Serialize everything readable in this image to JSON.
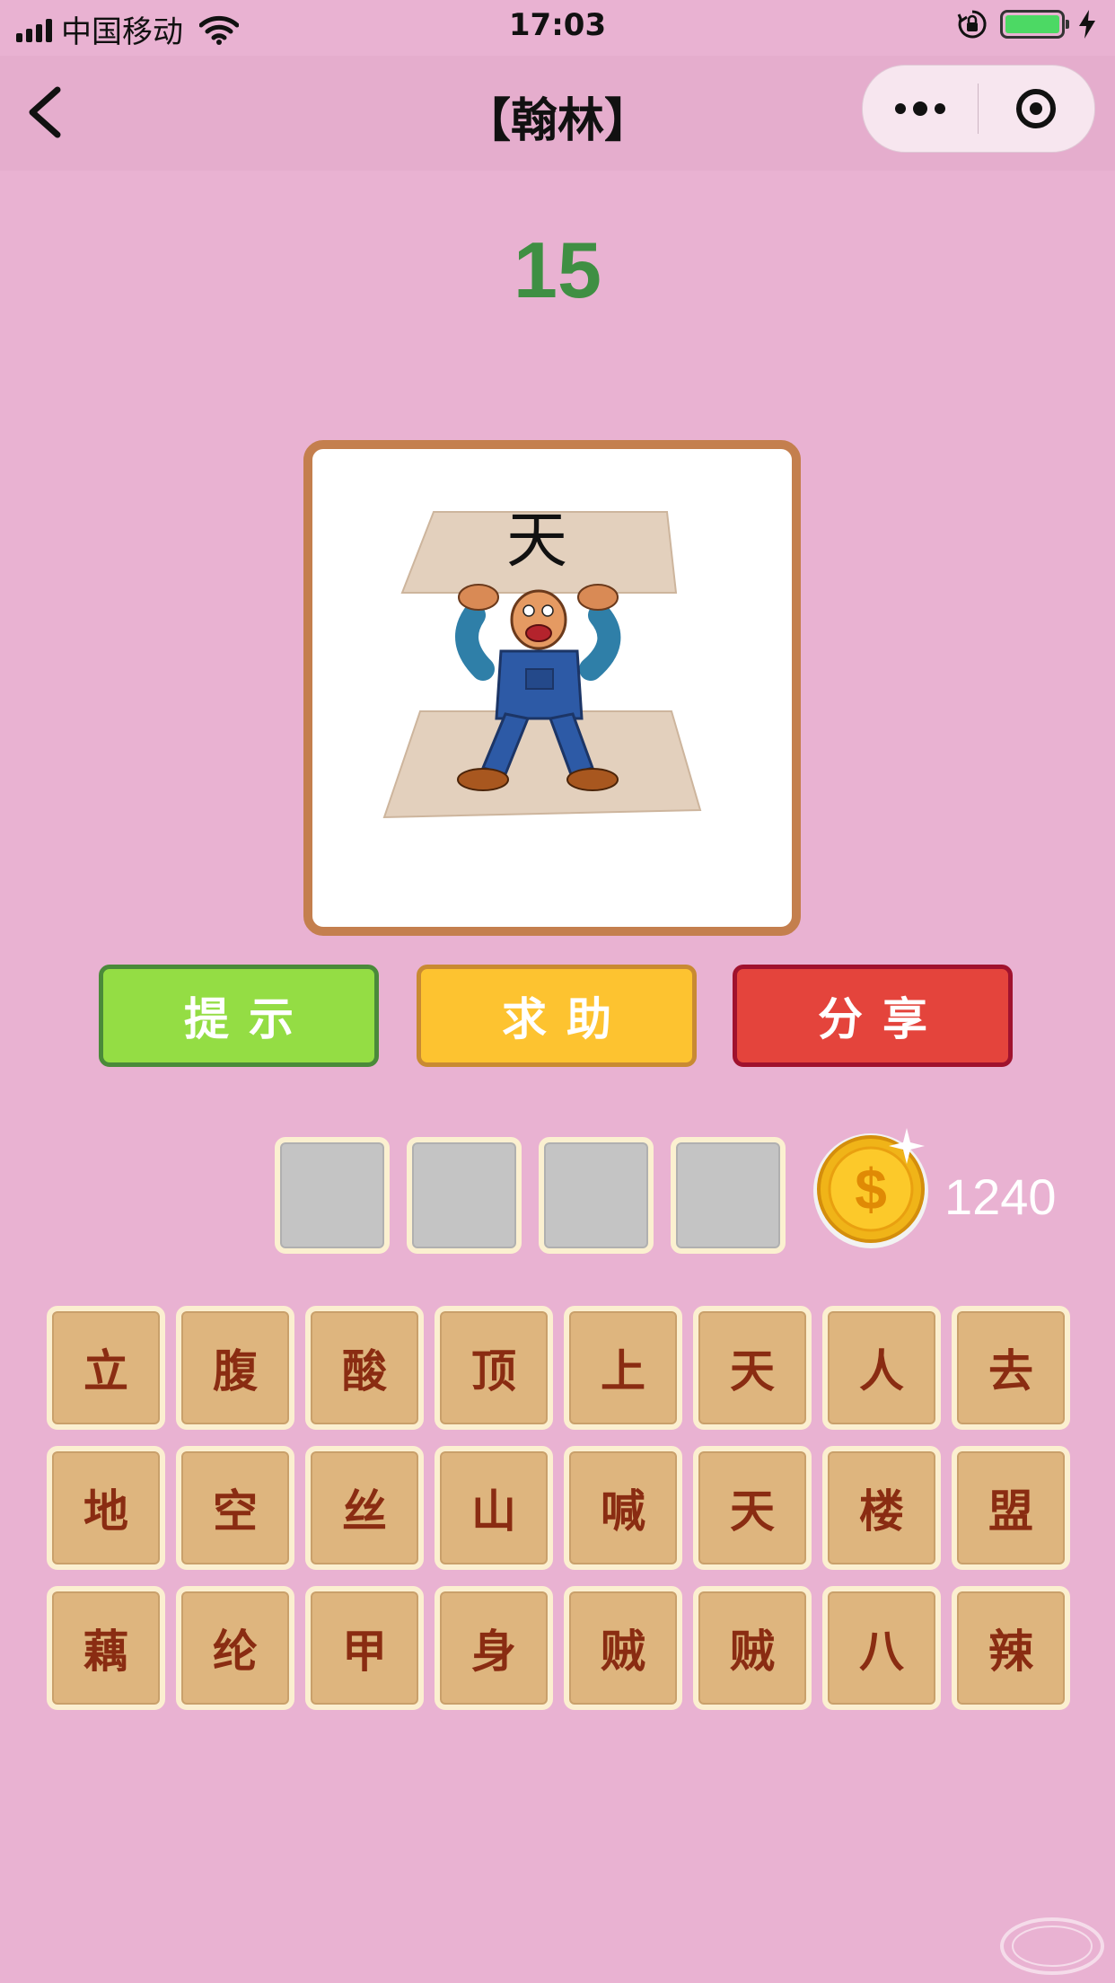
{
  "status_bar": {
    "carrier": "中国移动",
    "time": "17:03",
    "battery_level": 1.0
  },
  "nav": {
    "title": "【翰林】"
  },
  "game": {
    "level": "15",
    "picture_character": "天",
    "buttons": {
      "hint": "提示",
      "help": "求助",
      "share": "分享"
    },
    "answer_slots": [
      "",
      "",
      "",
      ""
    ],
    "coins": "1240",
    "candidate_rows": [
      [
        "立",
        "腹",
        "酸",
        "顶",
        "上",
        "天",
        "人",
        "去"
      ],
      [
        "地",
        "空",
        "丝",
        "山",
        "喊",
        "天",
        "楼",
        "盟"
      ],
      [
        "藕",
        "纶",
        "甲",
        "身",
        "贼",
        "贼",
        "八",
        "辣"
      ]
    ]
  },
  "colors": {
    "background": "#e9b2d2",
    "level_text": "#3f8f43",
    "hint_button": "#94dd44",
    "help_button": "#fdc330",
    "share_button": "#e4443c",
    "tile": "#deb57e",
    "tile_text": "#8a2c12"
  },
  "icons": {
    "signal": "signal-bars-icon",
    "wifi": "wifi-icon",
    "orientation_lock": "orientation-lock-icon",
    "battery": "battery-icon",
    "charging": "charging-bolt-icon",
    "back": "chevron-left-icon",
    "more": "more-dots-icon",
    "close": "target-circle-icon",
    "coin": "gold-coin-dollar-icon"
  }
}
